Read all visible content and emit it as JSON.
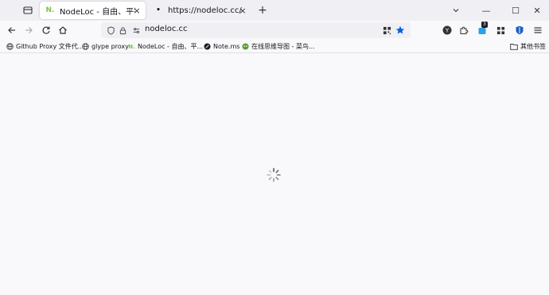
{
  "tabs": [
    {
      "title": "NodeLoc - 自由、平等、友好、",
      "favicon": "N.",
      "active": true,
      "close": "×"
    },
    {
      "title": "https://nodeloc.cc/",
      "favicon": "•",
      "active": false,
      "close": "×"
    }
  ],
  "new_tab": "+",
  "window_controls": {
    "minimize": "—",
    "maximize": "☐",
    "close": "✕"
  },
  "url": "nodeloc.cc",
  "toolbar_badge": "3",
  "bookmarks": [
    {
      "label": "Github Proxy 文件代...",
      "icon": "globe-icon"
    },
    {
      "label": "glype proxy",
      "icon": "globe-icon"
    },
    {
      "label": "NodeLoc - 自由、平...",
      "icon": "nodeloc-icon"
    },
    {
      "label": "Note.ms",
      "icon": "note-icon"
    },
    {
      "label": "在线思维导图 - 菜鸟...",
      "icon": "mindmap-icon"
    }
  ],
  "other_bookmarks": "其他书签",
  "colors": {
    "accent": "#0061e0",
    "badge": "#1f1e25",
    "nodeloc_green": "#7cc24a"
  }
}
